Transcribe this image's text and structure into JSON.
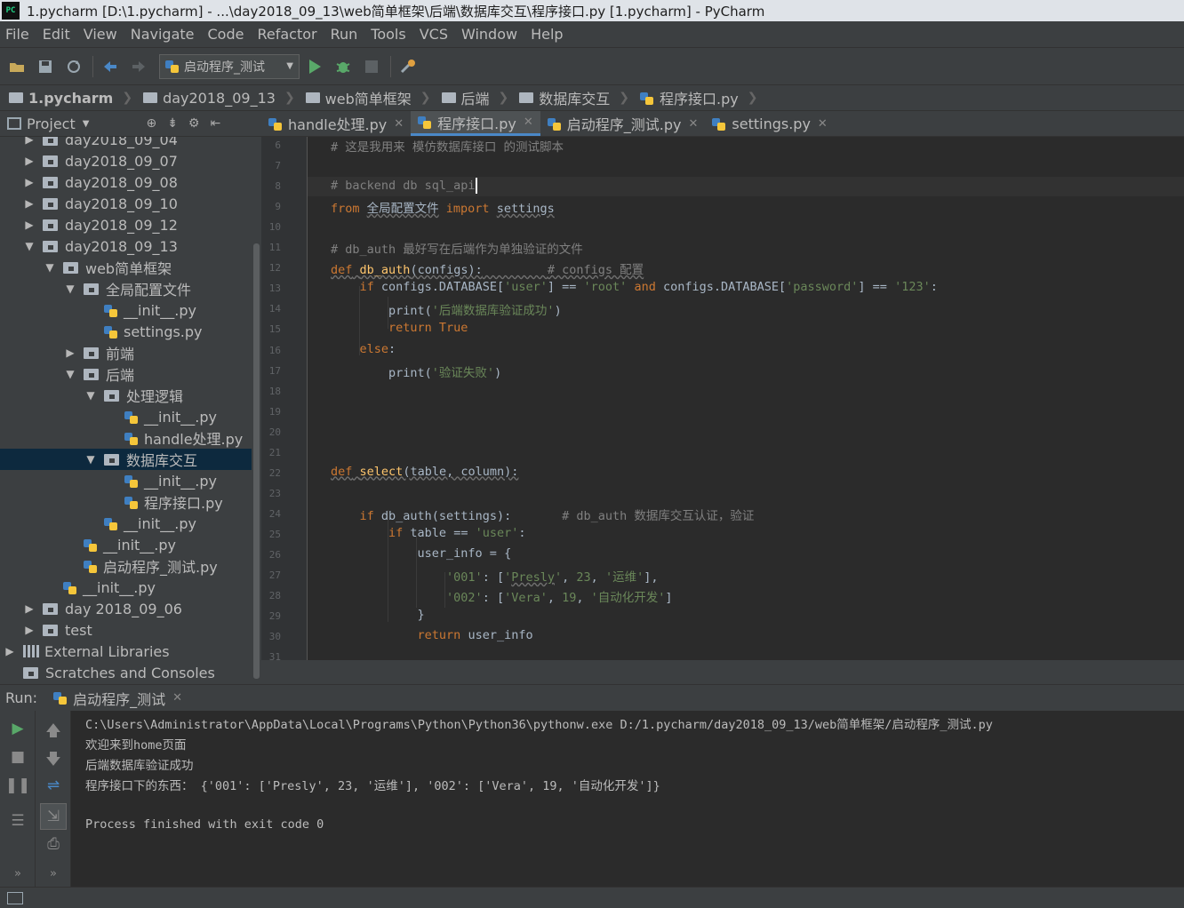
{
  "window": {
    "title": "1.pycharm [D:\\1.pycharm] - ...\\day2018_09_13\\web简单框架\\后端\\数据库交互\\程序接口.py [1.pycharm] - PyCharm",
    "icon_text": "PC"
  },
  "menu": [
    "File",
    "Edit",
    "View",
    "Navigate",
    "Code",
    "Refactor",
    "Run",
    "Tools",
    "VCS",
    "Window",
    "Help"
  ],
  "toolbar": {
    "run_config": "启动程序_测试",
    "icons": [
      "open-folder-icon",
      "save-icon",
      "sync-icon",
      "back-icon",
      "forward-icon",
      "run-icon",
      "debug-icon",
      "stop-icon",
      "settings-icon"
    ]
  },
  "breadcrumb": [
    "1.pycharm",
    "day2018_09_13",
    "web简单框架",
    "后端",
    "数据库交互",
    "程序接口.py"
  ],
  "project_panel": {
    "title": "Project",
    "tree": [
      {
        "label": "day2018_09_04",
        "type": "folder",
        "expanded": false,
        "depth": 0
      },
      {
        "label": "day2018_09_07",
        "type": "folder",
        "expanded": false,
        "depth": 0
      },
      {
        "label": "day2018_09_08",
        "type": "folder",
        "expanded": false,
        "depth": 0
      },
      {
        "label": "day2018_09_10",
        "type": "folder",
        "expanded": false,
        "depth": 0
      },
      {
        "label": "day2018_09_12",
        "type": "folder",
        "expanded": false,
        "depth": 0
      },
      {
        "label": "day2018_09_13",
        "type": "folder",
        "expanded": true,
        "depth": 0
      },
      {
        "label": "web简单框架",
        "type": "folder",
        "expanded": true,
        "depth": 1
      },
      {
        "label": "全局配置文件",
        "type": "folder",
        "expanded": true,
        "depth": 2
      },
      {
        "label": "__init__.py",
        "type": "py",
        "depth": 3
      },
      {
        "label": "settings.py",
        "type": "py",
        "depth": 3
      },
      {
        "label": "前端",
        "type": "folder",
        "expanded": false,
        "depth": 2
      },
      {
        "label": "后端",
        "type": "folder",
        "expanded": true,
        "depth": 2
      },
      {
        "label": "处理逻辑",
        "type": "folder",
        "expanded": true,
        "depth": 3
      },
      {
        "label": "__init__.py",
        "type": "py",
        "depth": 4
      },
      {
        "label": "handle处理.py",
        "type": "py",
        "depth": 4
      },
      {
        "label": "数据库交互",
        "type": "folder",
        "expanded": true,
        "depth": 3,
        "selected": true
      },
      {
        "label": "__init__.py",
        "type": "py",
        "depth": 4
      },
      {
        "label": "程序接口.py",
        "type": "py",
        "depth": 4
      },
      {
        "label": "__init__.py",
        "type": "py",
        "depth": 3
      },
      {
        "label": "__init__.py",
        "type": "py",
        "depth": 2
      },
      {
        "label": "启动程序_测试.py",
        "type": "py",
        "depth": 2
      },
      {
        "label": "__init__.py",
        "type": "py",
        "depth": 1
      },
      {
        "label": "day 2018_09_06",
        "type": "folder",
        "expanded": false,
        "depth": 0
      },
      {
        "label": "test",
        "type": "folder",
        "expanded": false,
        "depth": 0
      },
      {
        "label": "External Libraries",
        "type": "lib",
        "expanded": false,
        "depth": -1
      },
      {
        "label": "Scratches and Consoles",
        "type": "scratch",
        "depth": -1
      }
    ]
  },
  "editor_tabs": [
    {
      "label": "handle处理.py",
      "active": false
    },
    {
      "label": "程序接口.py",
      "active": true
    },
    {
      "label": "启动程序_测试.py",
      "active": false
    },
    {
      "label": "settings.py",
      "active": false
    }
  ],
  "code": {
    "line_numbers": [
      "6",
      "7",
      "8",
      "9",
      "10",
      "11",
      "12",
      "13",
      "14",
      "15",
      "16",
      "17",
      "18",
      "19",
      "20",
      "21",
      "22",
      "23",
      "24",
      "25",
      "26",
      "27",
      "28",
      "29",
      "30",
      "31"
    ],
    "lines": [
      [
        {
          "t": "# 这是我用来 模仿数据库接口 的测试脚本",
          "c": "cm"
        }
      ],
      [],
      [
        {
          "t": "# backend db sql_api",
          "c": "cm"
        },
        {
          "t": "",
          "c": "cursor"
        }
      ],
      [
        {
          "t": "from",
          "c": "kw"
        },
        {
          "t": " "
        },
        {
          "t": "全局配置文件",
          "c": "ul"
        },
        {
          "t": " "
        },
        {
          "t": "import",
          "c": "kw"
        },
        {
          "t": " "
        },
        {
          "t": "settings",
          "c": "ul"
        }
      ],
      [],
      [
        {
          "t": "# db_auth 最好写在后端作为单独验证的文件",
          "c": "cm"
        }
      ],
      [
        {
          "t": "def",
          "c": "kw ul"
        },
        {
          "t": " ",
          "c": "ul"
        },
        {
          "t": "db_auth",
          "c": "fn ul"
        },
        {
          "t": "(configs):",
          "c": "ul"
        },
        {
          "t": "         ",
          "c": "ul"
        },
        {
          "t": "# configs 配置",
          "c": "cm ul"
        }
      ],
      [
        {
          "t": "    "
        },
        {
          "t": "if",
          "c": "kw"
        },
        {
          "t": " configs.DATABASE["
        },
        {
          "t": "'user'",
          "c": "st"
        },
        {
          "t": "] == "
        },
        {
          "t": "'root'",
          "c": "st"
        },
        {
          "t": " "
        },
        {
          "t": "and",
          "c": "kw"
        },
        {
          "t": " configs.DATABASE["
        },
        {
          "t": "'password'",
          "c": "st"
        },
        {
          "t": "] == "
        },
        {
          "t": "'123'",
          "c": "st"
        },
        {
          "t": ":"
        }
      ],
      [
        {
          "t": "        print("
        },
        {
          "t": "'后端数据库验证成功'",
          "c": "st"
        },
        {
          "t": ")"
        }
      ],
      [
        {
          "t": "        "
        },
        {
          "t": "return True",
          "c": "kw"
        }
      ],
      [
        {
          "t": "    "
        },
        {
          "t": "else",
          "c": "kw"
        },
        {
          "t": ":"
        }
      ],
      [
        {
          "t": "        print("
        },
        {
          "t": "'验证失败'",
          "c": "st"
        },
        {
          "t": ")"
        }
      ],
      [],
      [],
      [],
      [],
      [
        {
          "t": "def",
          "c": "kw ul"
        },
        {
          "t": " ",
          "c": "ul"
        },
        {
          "t": "select",
          "c": "fn ul"
        },
        {
          "t": "(table, column):",
          "c": "ul"
        }
      ],
      [],
      [
        {
          "t": "    "
        },
        {
          "t": "if",
          "c": "kw"
        },
        {
          "t": " db_auth(settings):       "
        },
        {
          "t": "# db_auth 数据库交互认证，验证",
          "c": "cm"
        }
      ],
      [
        {
          "t": "        "
        },
        {
          "t": "if",
          "c": "kw"
        },
        {
          "t": " table == "
        },
        {
          "t": "'user'",
          "c": "st"
        },
        {
          "t": ":"
        }
      ],
      [
        {
          "t": "            user_info = {"
        }
      ],
      [
        {
          "t": "                "
        },
        {
          "t": "'001'",
          "c": "st"
        },
        {
          "t": ": ["
        },
        {
          "t": "'",
          "c": "st"
        },
        {
          "t": "Presly",
          "c": "st ul"
        },
        {
          "t": "'",
          "c": "st"
        },
        {
          "t": ", "
        },
        {
          "t": "23",
          "c": "st"
        },
        {
          "t": ", "
        },
        {
          "t": "'运维'",
          "c": "st"
        },
        {
          "t": "],"
        }
      ],
      [
        {
          "t": "                "
        },
        {
          "t": "'002'",
          "c": "st"
        },
        {
          "t": ": ["
        },
        {
          "t": "'Vera'",
          "c": "st"
        },
        {
          "t": ", "
        },
        {
          "t": "19",
          "c": "st"
        },
        {
          "t": ", "
        },
        {
          "t": "'自动化开发'",
          "c": "st"
        },
        {
          "t": "]"
        }
      ],
      [
        {
          "t": "            }"
        }
      ],
      [
        {
          "t": "            "
        },
        {
          "t": "return",
          "c": "kw"
        },
        {
          "t": " user_info"
        }
      ],
      []
    ]
  },
  "run_panel": {
    "label": "Run:",
    "tab": "启动程序_测试",
    "output": [
      "C:\\Users\\Administrator\\AppData\\Local\\Programs\\Python\\Python36\\pythonw.exe D:/1.pycharm/day2018_09_13/web简单框架/启动程序_测试.py",
      "欢迎来到home页面",
      "后端数据库验证成功",
      "程序接口下的东西： {'001': ['Presly', 23, '运维'], '002': ['Vera', 19, '自动化开发']}",
      "",
      "Process finished with exit code 0"
    ]
  },
  "colors": {
    "ide_bg": "#3c3f41",
    "editor_bg": "#2b2b2b",
    "keyword": "#cc7832",
    "comment": "#808080",
    "string": "#6a8759",
    "function": "#ffc66d",
    "selection": "#0d293e"
  }
}
